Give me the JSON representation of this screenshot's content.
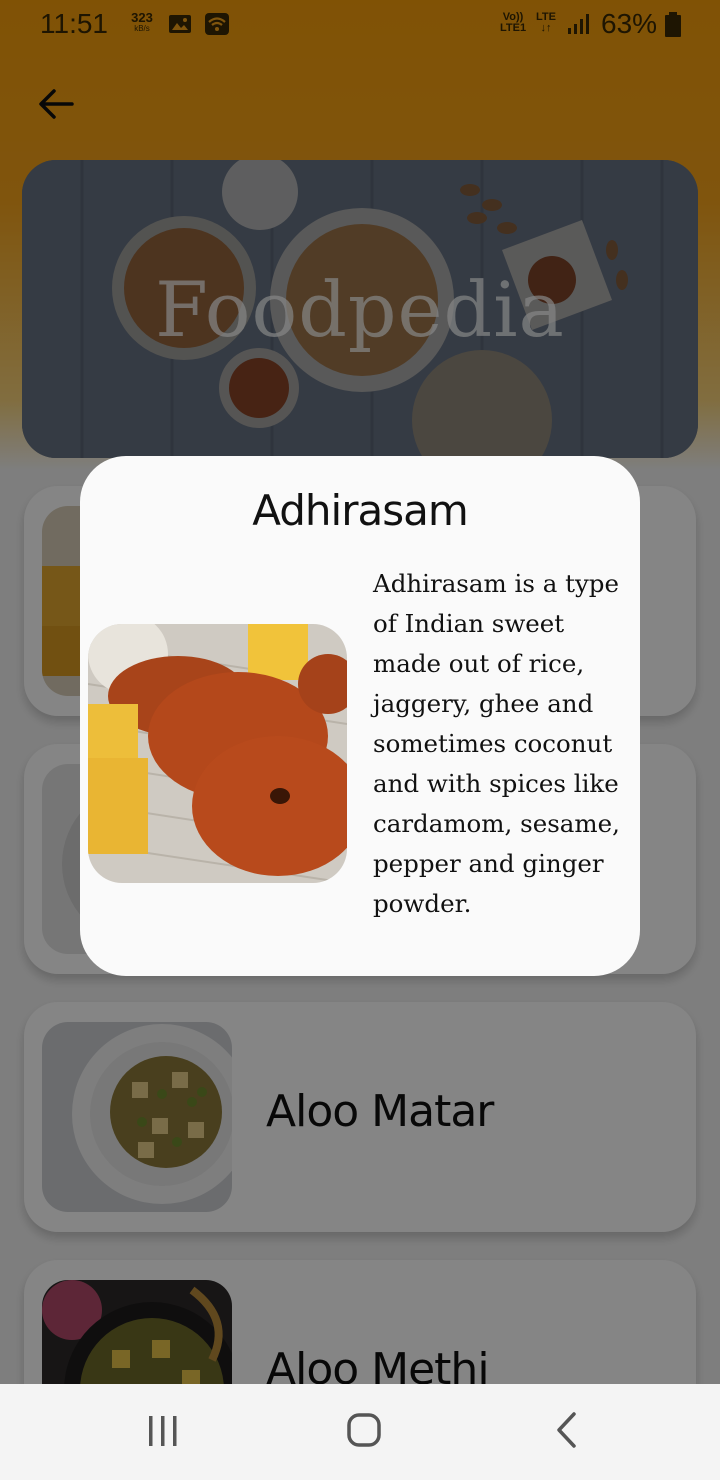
{
  "status_bar": {
    "time": "11:51",
    "speed_value": "323",
    "speed_unit": "kB/s",
    "volte": "Vo))",
    "volte_sub": "LTE1",
    "lte": "LTE",
    "battery": "63%"
  },
  "banner": {
    "title": "Foodpedia"
  },
  "food_list": [
    {
      "name": ""
    },
    {
      "name": ""
    },
    {
      "name": "Aloo Matar"
    },
    {
      "name": "Aloo Methi"
    }
  ],
  "dialog": {
    "title": "Adhirasam",
    "description": "Adhirasam is a type of Indian sweet made out of rice, jaggery, ghee and sometimes coconut and with spices like cardamom, sesame, pepper and ginger powder."
  },
  "icons": {
    "back": "arrow-left-icon",
    "recents": "recents-icon",
    "home": "home-icon",
    "nav_back": "chevron-left-icon"
  },
  "colors": {
    "header": "#f59e0b",
    "dialog_bg": "#fafafa",
    "scrim": "rgba(0,0,0,0.48)"
  }
}
